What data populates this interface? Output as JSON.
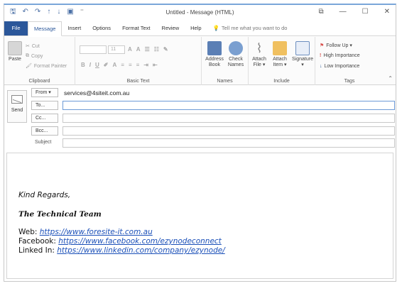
{
  "window": {
    "title": "Untitled  -  Message (HTML)",
    "controls": [
      "⧉",
      "—",
      "☐",
      "✕"
    ]
  },
  "tabs": [
    {
      "label": "File"
    },
    {
      "label": "Message"
    },
    {
      "label": "Insert"
    },
    {
      "label": "Options"
    },
    {
      "label": "Format Text"
    },
    {
      "label": "Review"
    },
    {
      "label": "Help"
    }
  ],
  "tell_me": "Tell me what you want to do",
  "ribbon": {
    "clipboard": {
      "label": "Clipboard",
      "paste": "Paste",
      "cut": "Cut",
      "copy": "Copy",
      "format_painter": "Format Painter"
    },
    "basic_text": {
      "label": "Basic Text",
      "font_size": "11"
    },
    "names": {
      "label": "Names",
      "address_book": [
        "Address",
        "Book"
      ],
      "check_names": [
        "Check",
        "Names"
      ]
    },
    "include": {
      "label": "Include",
      "attach_file": [
        "Attach",
        "File ▾"
      ],
      "attach_item": [
        "Attach",
        "Item ▾"
      ],
      "signature": [
        "Signature",
        "▾"
      ]
    },
    "tags": {
      "label": "Tags",
      "follow_up": "Follow Up ▾",
      "high": "High Importance",
      "low": "Low Importance"
    }
  },
  "compose": {
    "send": "Send",
    "from_label": "From ▾",
    "from_value": "services@4siteit.com.au",
    "to": "To...",
    "cc": "Cc...",
    "bcc": "Bcc...",
    "subject": "Subject"
  },
  "signature": {
    "regards": "Kind Regards,",
    "team": "The Technical Team",
    "web_label": "Web:",
    "web_url": "https://www.foresite-it.com.au",
    "facebook_label": "Facebook:",
    "facebook_url": "https://www.facebook.com/ezynodeconnect",
    "linkedin_label": "Linked In:",
    "linkedin_url": "https://www.linkedin.com/company/ezynode/"
  },
  "colors": {
    "file_tab": "#2b579a",
    "link": "#1a4fb8",
    "follow_up_flag": "#d9534f"
  }
}
